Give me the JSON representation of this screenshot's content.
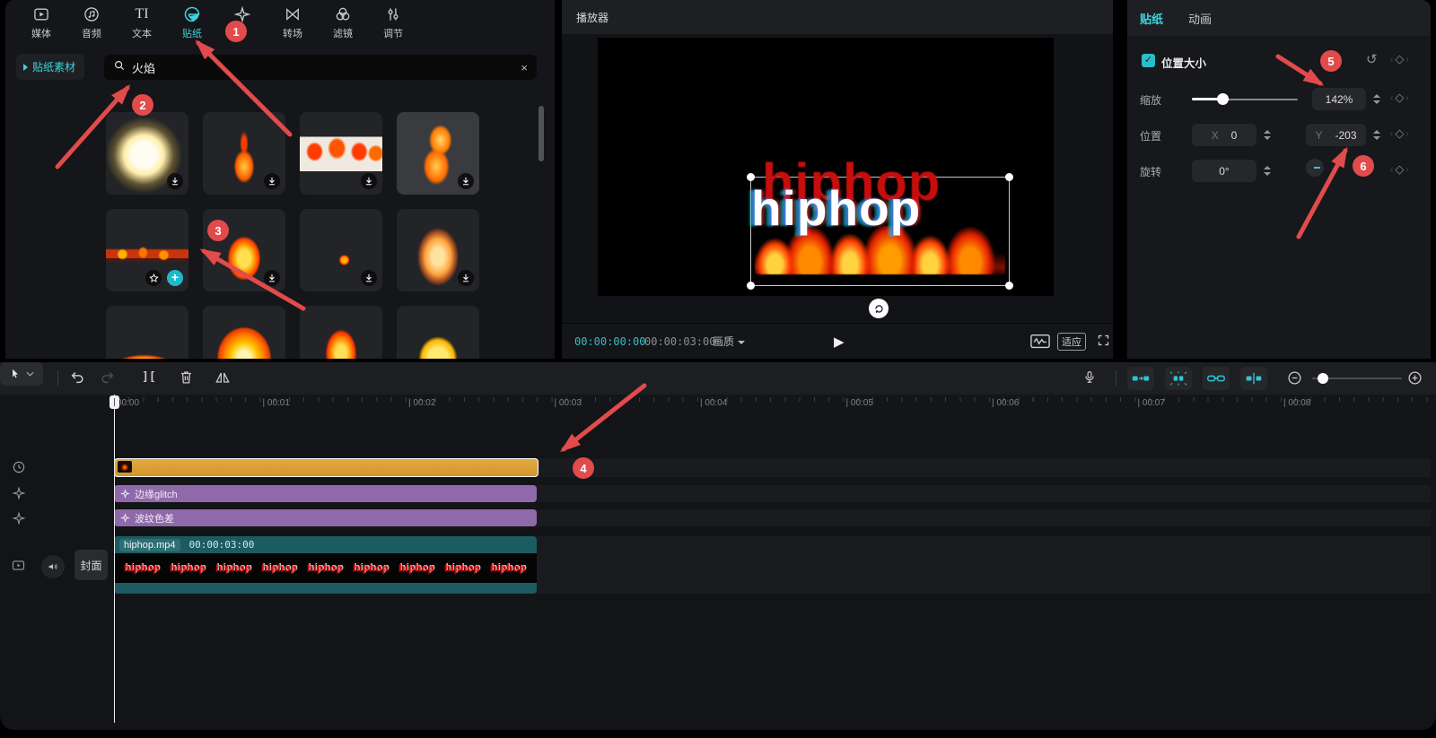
{
  "top_toolbar": {
    "items": [
      {
        "label": "媒体",
        "icon": "media-icon"
      },
      {
        "label": "音频",
        "icon": "audio-icon"
      },
      {
        "label": "文本",
        "icon": "text-icon"
      },
      {
        "label": "贴纸",
        "icon": "sticker-icon",
        "active": true
      },
      {
        "label": "",
        "icon": "effects-icon"
      },
      {
        "label": "转场",
        "icon": "transition-icon"
      },
      {
        "label": "滤镜",
        "icon": "filter-icon"
      },
      {
        "label": "调节",
        "icon": "adjust-icon"
      }
    ]
  },
  "sticker_panel": {
    "library_label": "贴纸素材",
    "search_query": "火焰",
    "close_label": "×",
    "tiles": [
      {
        "variant": "white-glow",
        "badges": [
          "download"
        ]
      },
      {
        "variant": "thin-flame",
        "badges": [
          "download"
        ]
      },
      {
        "variant": "flame-strip-light",
        "badges": [
          "download"
        ]
      },
      {
        "variant": "orange-flare",
        "badges": [
          "download"
        ],
        "highlight": true
      },
      {
        "variant": "ember-row",
        "badges": [
          "star",
          "add"
        ]
      },
      {
        "variant": "cartoon-flame",
        "badges": [
          "download"
        ]
      },
      {
        "variant": "ember-dot",
        "badges": [
          "download"
        ]
      },
      {
        "variant": "tall-fire",
        "badges": [
          "download"
        ]
      },
      {
        "variant": "jet-flame",
        "badges": []
      },
      {
        "variant": "big-cartoon-fire",
        "badges": []
      },
      {
        "variant": "cartoon-flame2",
        "badges": []
      },
      {
        "variant": "yellow-flame",
        "badges": []
      }
    ]
  },
  "player": {
    "title": "播放器",
    "preview_word": "hiphop",
    "current_time": "00:00:00:00",
    "duration": "00:00:03:00",
    "quality_label": "画质",
    "fit_label": "适应"
  },
  "inspector": {
    "tab_sticker": "贴纸",
    "tab_animation": "动画",
    "section_title": "位置大小",
    "checkbox_glyph": "✓",
    "reset_glyph": "↺",
    "keyframe_glyph": "◇",
    "scale": {
      "label": "缩放",
      "value": "142%"
    },
    "position": {
      "label": "位置",
      "x_label": "X",
      "x_value": "0",
      "y_label": "Y",
      "y_value": "-203"
    },
    "rotation": {
      "label": "旋转",
      "value": "0°"
    }
  },
  "timeline": {
    "ruler_labels": [
      "00:00",
      "00:01",
      "00:02",
      "00:03",
      "00:04",
      "00:05",
      "00:06",
      "00:07",
      "00:08"
    ],
    "split_glyph": "][",
    "cover_button": "封面",
    "effect_tracks": [
      {
        "label": "边缘glitch"
      },
      {
        "label": "波纹色差"
      }
    ],
    "video_track": {
      "name": "hiphop.mp4",
      "duration": "00:00:03:00",
      "filmstrip_words": [
        "hiphop",
        "hiphop",
        "hiphop",
        "hiphop",
        "hiphop",
        "hiphop",
        "hiphop",
        "hiphop",
        "hiphop"
      ]
    }
  },
  "annotations": {
    "badges": [
      "1",
      "2",
      "3",
      "4",
      "5",
      "6"
    ]
  },
  "colors": {
    "accent_teal": "#3fd3dc",
    "annotation_red": "#e14b4b",
    "sticker_track": "#d3952c",
    "effect_track": "#8f69a9",
    "video_track": "#1c5b61"
  }
}
